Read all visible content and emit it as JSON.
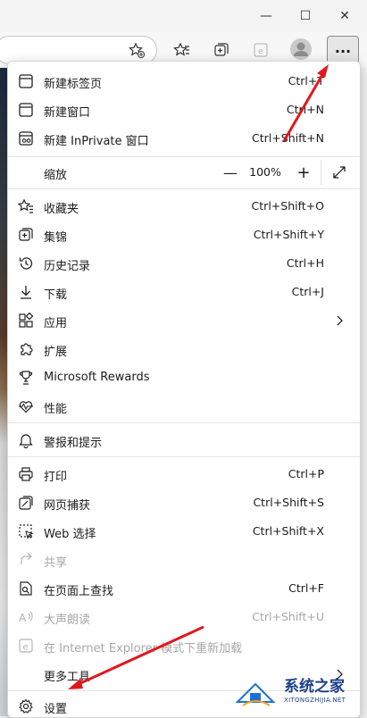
{
  "window": {
    "minimize_glyph": "—",
    "maximize_glyph": "☐",
    "close_glyph": "✕"
  },
  "toolbar": {
    "more_glyph": "···"
  },
  "menu": {
    "items": [
      {
        "label": "新建标签页",
        "shortcut": "Ctrl+T",
        "icon": "new-tab-icon"
      },
      {
        "label": "新建窗口",
        "shortcut": "Ctrl+N",
        "icon": "new-window-icon"
      },
      {
        "label": "新建 InPrivate 窗口",
        "shortcut": "Ctrl+Shift+N",
        "icon": "inprivate-icon"
      },
      {
        "label": "缩放",
        "icon": "zoom-icon"
      },
      {
        "label": "收藏夹",
        "shortcut": "Ctrl+Shift+O",
        "icon": "favorites-icon"
      },
      {
        "label": "集锦",
        "shortcut": "Ctrl+Shift+Y",
        "icon": "collections-icon"
      },
      {
        "label": "历史记录",
        "shortcut": "Ctrl+H",
        "icon": "history-icon"
      },
      {
        "label": "下载",
        "shortcut": "Ctrl+J",
        "icon": "download-icon"
      },
      {
        "label": "应用",
        "icon": "apps-icon"
      },
      {
        "label": "扩展",
        "icon": "extensions-icon"
      },
      {
        "label": "Microsoft Rewards",
        "icon": "rewards-icon"
      },
      {
        "label": "性能",
        "icon": "performance-icon"
      },
      {
        "label": "警报和提示",
        "icon": "bell-icon"
      },
      {
        "label": "打印",
        "shortcut": "Ctrl+P",
        "icon": "print-icon"
      },
      {
        "label": "网页捕获",
        "shortcut": "Ctrl+Shift+S",
        "icon": "capture-icon"
      },
      {
        "label": "Web 选择",
        "shortcut": "Ctrl+Shift+X",
        "icon": "web-select-icon"
      },
      {
        "label": "共享",
        "icon": "share-icon",
        "disabled": true
      },
      {
        "label": "在页面上查找",
        "shortcut": "Ctrl+F",
        "icon": "find-icon"
      },
      {
        "label": "大声朗读",
        "shortcut": "Ctrl+Shift+U",
        "icon": "read-aloud-icon",
        "disabled": true
      },
      {
        "label": "在 Internet Explorer 模式下重新加载",
        "icon": "ie-icon",
        "disabled": true
      },
      {
        "label": "更多工具",
        "icon": "more-tools-icon"
      },
      {
        "label": "设置",
        "icon": "settings-icon"
      }
    ],
    "zoom": {
      "minus": "—",
      "value": "100%",
      "plus": "+"
    }
  },
  "watermark": {
    "title": "系统之家",
    "subtitle": "XITONGZHIJIA.NET"
  },
  "colors": {
    "accent_arrow": "#e0191e",
    "watermark_blue": "#1d3f8a"
  }
}
